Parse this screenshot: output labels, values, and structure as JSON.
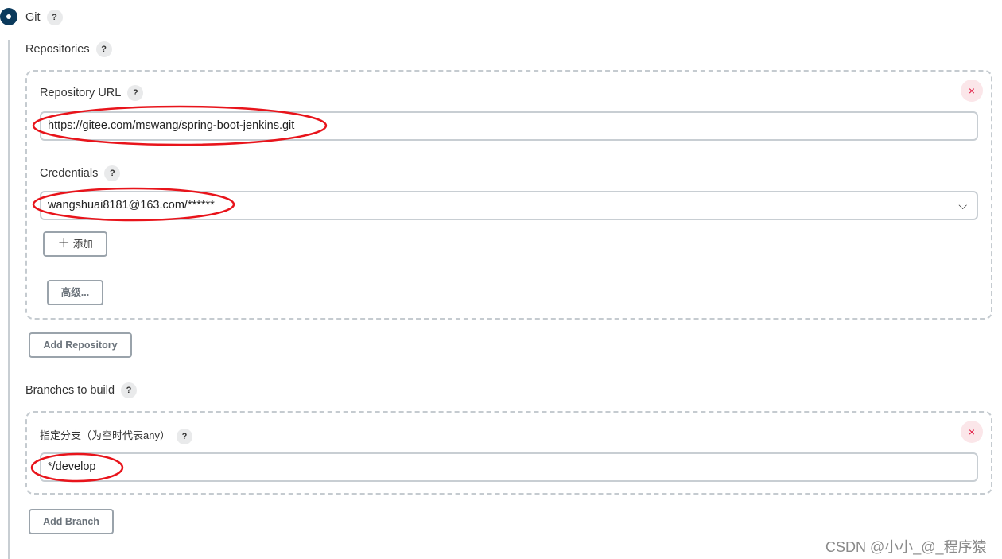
{
  "git": {
    "label": "Git",
    "help": "?"
  },
  "repositories": {
    "label": "Repositories",
    "help": "?"
  },
  "repo": {
    "url_label": "Repository URL",
    "url_value": "https://gitee.com/mswang/spring-boot-jenkins.git",
    "credentials_label": "Credentials",
    "credentials_value": "wangshuai8181@163.com/******",
    "add_label": "添加",
    "advanced_label": "高级...",
    "close": "×"
  },
  "add_repository": "Add Repository",
  "branches": {
    "label": "Branches to build",
    "help": "?",
    "spec_label": "指定分支（为空时代表any）",
    "spec_value": "*/develop",
    "close": "×"
  },
  "add_branch": "Add Branch",
  "watermark": "CSDN @小小_@_程序猿",
  "colors": {
    "radio": "#0b3a5c",
    "annotation": "#e8141b",
    "close": "#e0163f"
  }
}
